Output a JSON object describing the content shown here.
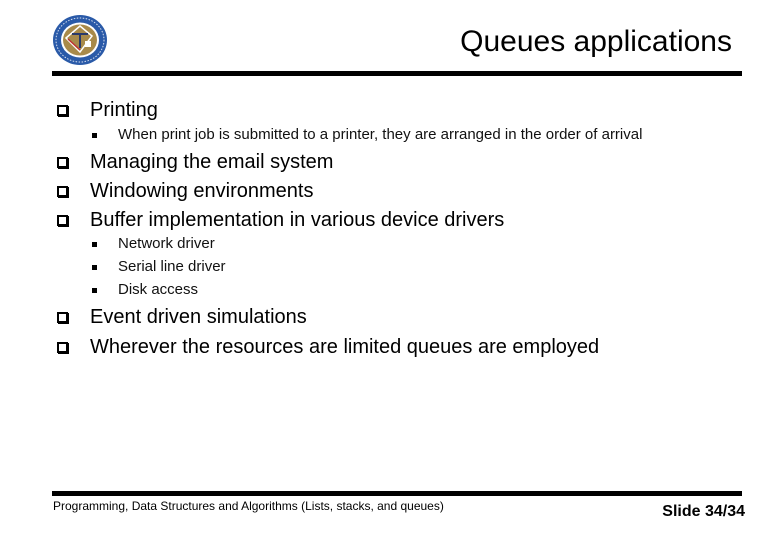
{
  "slide": {
    "title": "Queues applications",
    "logo": "university-seal-emblem",
    "bullets": [
      {
        "text": "Printing",
        "sub": [
          "When print job is submitted to a printer, they are arranged in the order of arrival"
        ]
      },
      {
        "text": "Managing the email system",
        "sub": []
      },
      {
        "text": "Windowing environments",
        "sub": []
      },
      {
        "text": "Buffer implementation in various device drivers",
        "sub": [
          "Network driver",
          "Serial line driver",
          "Disk access"
        ]
      },
      {
        "text": "Event driven simulations",
        "sub": []
      },
      {
        "text": "Wherever the resources are limited queues are employed",
        "sub": []
      }
    ]
  },
  "footer": {
    "course": "Programming, Data Structures and Algorithms  (Lists, stacks, and queues)",
    "slide_number": "Slide 34/34"
  },
  "colors": {
    "text": "#000000",
    "background": "#ffffff",
    "logo_outer": "#2a5aa8",
    "logo_inner": "#a88a4a"
  }
}
